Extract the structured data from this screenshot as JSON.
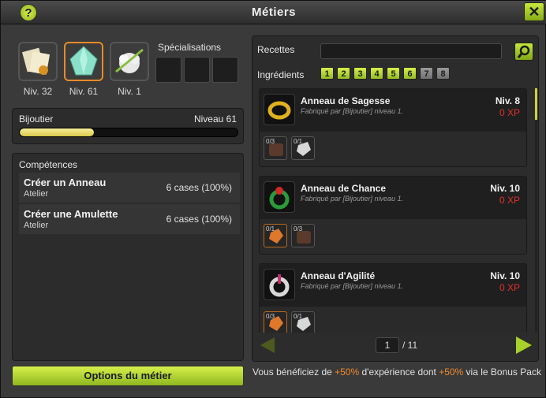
{
  "window": {
    "title": "Métiers"
  },
  "jobs": [
    {
      "icon": "parchment-icon",
      "level": "Niv. 32",
      "active": false
    },
    {
      "icon": "crystal-icon",
      "level": "Niv. 61",
      "active": true
    },
    {
      "icon": "wool-icon",
      "level": "Niv. 1",
      "active": false
    }
  ],
  "specialisations": {
    "title": "Spécialisations"
  },
  "current_job": {
    "name": "Bijoutier",
    "level": "Niveau 61",
    "progress_fraction": 0.34
  },
  "skills": {
    "title": "Compétences",
    "items": [
      {
        "name": "Créer un Anneau",
        "place": "Atelier",
        "cases": "6 cases (100%)"
      },
      {
        "name": "Créer une Amulette",
        "place": "Atelier",
        "cases": "6 cases (100%)"
      }
    ]
  },
  "options_button": "Options du métier",
  "recipes_panel": {
    "recettes_label": "Recettes",
    "search_value": "",
    "ingredients_label": "Ingrédients",
    "ingredient_filters": [
      {
        "label": "1",
        "on": true
      },
      {
        "label": "2",
        "on": true
      },
      {
        "label": "3",
        "on": true
      },
      {
        "label": "4",
        "on": true
      },
      {
        "label": "5",
        "on": true
      },
      {
        "label": "6",
        "on": true
      },
      {
        "label": "7",
        "on": false
      },
      {
        "label": "8",
        "on": false
      }
    ],
    "recipes": [
      {
        "name": "Anneau de Sagesse",
        "maker": "Fabriqué par [Bijoutier] niveau 1.",
        "level": "Niv. 8",
        "xp": "0 XP",
        "icon": "gold-ring-icon",
        "ingredients": [
          {
            "count": "0/3",
            "icon": "leather-icon"
          },
          {
            "count": "0/1",
            "icon": "silver-ore-icon"
          }
        ]
      },
      {
        "name": "Anneau de Chance",
        "maker": "Fabriqué par [Bijoutier] niveau 1.",
        "level": "Niv. 10",
        "xp": "0 XP",
        "icon": "green-ring-icon",
        "ingredients": [
          {
            "count": "0/1",
            "icon": "amber-icon"
          },
          {
            "count": "0/3",
            "icon": "leather-icon"
          }
        ]
      },
      {
        "name": "Anneau d'Agilité",
        "maker": "Fabriqué par [Bijoutier] niveau 1.",
        "level": "Niv. 10",
        "xp": "0 XP",
        "icon": "silver-ring-icon",
        "ingredients": [
          {
            "count": "0/3",
            "icon": "amber-icon"
          },
          {
            "count": "0/1",
            "icon": "silver-ore-icon"
          }
        ]
      }
    ],
    "pagination": {
      "current": "1",
      "total": "/ 11"
    }
  },
  "bonus": {
    "part1": "Vous bénéficiez de ",
    "hl1": "+50%",
    "part2": " d'expérience dont ",
    "hl2": "+50%",
    "part3": " via le Bonus Pack"
  }
}
